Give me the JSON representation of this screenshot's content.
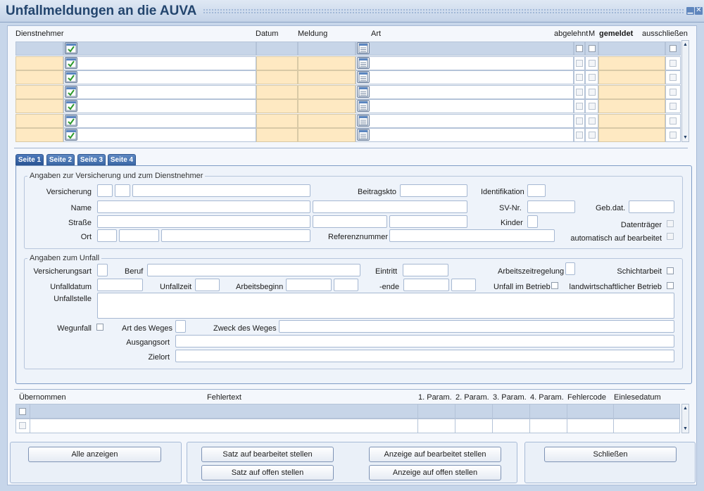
{
  "window": {
    "title": "Unfallmeldungen an die AUVA",
    "minimize_icon": "minimize-icon",
    "close_icon": "close-icon"
  },
  "grid": {
    "headers": {
      "dienstnehmer": "Dienstnehmer",
      "datum": "Datum",
      "meldung": "Meldung",
      "art": "Art",
      "abgelehnt": "abgelehnt",
      "m": "M",
      "gemeldet": "gemeldet",
      "ausschliessen": "ausschließen"
    },
    "row_count": 7,
    "row_icon": "checked-document-icon",
    "art_icon": "calendar-list-icon"
  },
  "tabs": [
    {
      "label": "Seite 1"
    },
    {
      "label": "Seite 2"
    },
    {
      "label": "Seite 3"
    },
    {
      "label": "Seite 4"
    }
  ],
  "versicherung": {
    "group_title": "Angaben zur Versicherung und zum Dienstnehmer",
    "versicherung": "Versicherung",
    "beitragskto": "Beitragskto",
    "identifikation": "Identifikation",
    "name": "Name",
    "svnr": "SV-Nr.",
    "gebdat": "Geb.dat.",
    "strasse": "Straße",
    "kinder": "Kinder",
    "datentraeger": "Datenträger",
    "ort": "Ort",
    "referenznummer": "Referenznummer",
    "automatisch": "automatisch auf bearbeitet"
  },
  "unfall": {
    "group_title": "Angaben zum Unfall",
    "versicherungsart": "Versicherungsart",
    "beruf": "Beruf",
    "eintritt": "Eintritt",
    "arbeitszeitregelung": "Arbeitszeitregelung",
    "schichtarbeit": "Schichtarbeit",
    "unfalldatum": "Unfalldatum",
    "unfallzeit": "Unfallzeit",
    "arbeitsbeginn": "Arbeitsbeginn",
    "ende": "-ende",
    "unfall_im_betrieb": "Unfall im Betrieb",
    "landwirtschaftlich": "landwirtschaftlicher Betrieb",
    "unfallstelle": "Unfallstelle",
    "wegunfall": "Wegunfall",
    "art_des_weges": "Art des Weges",
    "zweck_des_weges": "Zweck des Weges",
    "ausgangsort": "Ausgangsort",
    "zielort": "Zielort"
  },
  "errors": {
    "headers": {
      "uebernommen": "Übernommen",
      "fehlertext": "Fehlertext",
      "p1": "1. Param.",
      "p2": "2. Param.",
      "p3": "3. Param.",
      "p4": "4. Param.",
      "fehlercode": "Fehlercode",
      "einlesedatum": "Einlesedatum"
    }
  },
  "buttons": {
    "alle_anzeigen": "Alle anzeigen",
    "satz_bearbeitet": "Satz auf bearbeitet stellen",
    "satz_offen": "Satz auf offen stellen",
    "anzeige_bearbeitet": "Anzeige auf bearbeitet stellen",
    "anzeige_offen": "Anzeige auf offen stellen",
    "schliessen": "Schließen"
  },
  "colors": {
    "accent": "#23456e",
    "row_highlight": "#c7d5e8",
    "yellow_cell": "#fee9c2",
    "tab": "#3d6aa8"
  }
}
